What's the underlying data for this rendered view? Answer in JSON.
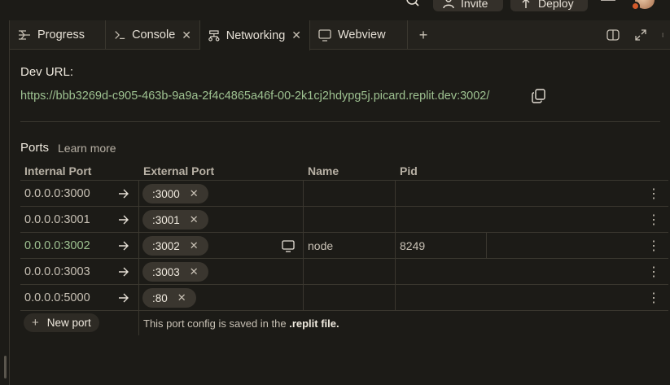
{
  "header": {
    "invite_label": "Invite",
    "deploy_label": "Deploy"
  },
  "tabs": [
    {
      "label": "Progress",
      "icon": "progress-icon"
    },
    {
      "label": "Console",
      "icon": "terminal-icon"
    },
    {
      "label": "Networking",
      "icon": "network-icon"
    },
    {
      "label": "Webview",
      "icon": "monitor-icon"
    }
  ],
  "dev": {
    "label": "Dev URL:",
    "url": "https://bbb3269d-c905-463b-9a9a-2f4c4865a46f-00-2k1cj2hdypg5j.picard.replit.dev:3002/"
  },
  "ports": {
    "title": "Ports",
    "learn_more": "Learn more",
    "columns": {
      "internal": "Internal Port",
      "external": "External Port",
      "name": "Name",
      "pid": "Pid"
    },
    "rows": [
      {
        "internal": "0.0.0.0:3000",
        "external": ":3000",
        "name": "",
        "pid": ""
      },
      {
        "internal": "0.0.0.0:3001",
        "external": ":3001",
        "name": "",
        "pid": ""
      },
      {
        "internal": "0.0.0.0:3002",
        "external": ":3002",
        "name": "node",
        "pid": "8249"
      },
      {
        "internal": "0.0.0.0:3003",
        "external": ":3003",
        "name": "",
        "pid": ""
      },
      {
        "internal": "0.0.0.0:5000",
        "external": ":80",
        "name": "",
        "pid": ""
      }
    ],
    "new_port_label": "New port",
    "note_prefix": "This port config is saved in the",
    "note_file": ".replit file."
  },
  "colors": {
    "background": "#1c1b17",
    "url_green": "#9ec291",
    "chip": "#3a362f"
  }
}
